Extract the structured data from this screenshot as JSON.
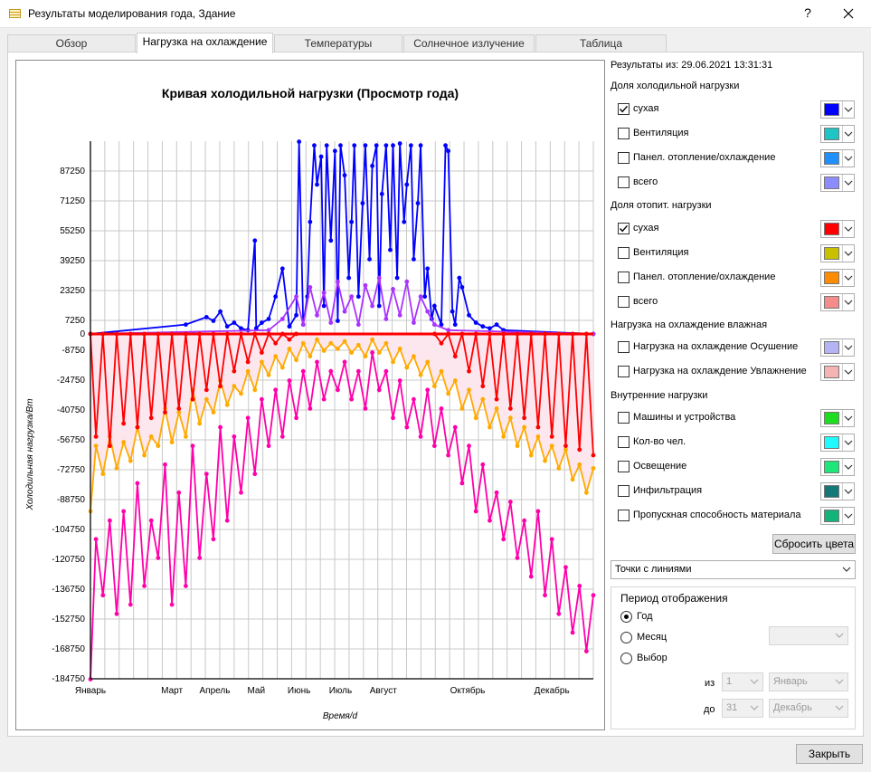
{
  "window": {
    "title": "Результаты моделирования года, Здание",
    "help_glyph": "?",
    "close_glyph": "✕"
  },
  "tabs": [
    {
      "label": "Обзор",
      "active": false
    },
    {
      "label": "Нагрузка на охлаждение",
      "active": true
    },
    {
      "label": "Температуры",
      "active": false
    },
    {
      "label": "Солнечное излучение",
      "active": false
    },
    {
      "label": "Таблица",
      "active": false
    }
  ],
  "chart_data": {
    "type": "line",
    "title": "Кривая холодильной нагрузки (Просмотр года)",
    "xlabel": "Время/d",
    "ylabel": "Холодильная нагрузка/Вт",
    "xlim": [
      1,
      365
    ],
    "ylim": [
      -184750,
      103250
    ],
    "y_ticks": [
      "87250",
      "71250",
      "55250",
      "39250",
      "23250",
      "7250",
      "0",
      "-8750",
      "-24750",
      "-40750",
      "-56750",
      "-72750",
      "-88750",
      "-104750",
      "-120750",
      "-136750",
      "-152750",
      "-168750",
      "-184750"
    ],
    "x_ticks": [
      {
        "day": 1,
        "label": "Январь"
      },
      {
        "day": 60,
        "label": "Март"
      },
      {
        "day": 91,
        "label": "Апрель"
      },
      {
        "day": 121,
        "label": "Май"
      },
      {
        "day": 152,
        "label": "Июнь"
      },
      {
        "day": 182,
        "label": "Июль"
      },
      {
        "day": 213,
        "label": "Август"
      },
      {
        "day": 274,
        "label": "Октябрь"
      },
      {
        "day": 335,
        "label": "Декабрь"
      }
    ],
    "grid": true,
    "series": [
      {
        "name": "сухая (доля холодильной нагрузки)",
        "color": "#0000ff",
        "x": [
          1,
          70,
          85,
          90,
          95,
          100,
          105,
          110,
          115,
          120,
          121,
          125,
          130,
          135,
          140,
          145,
          150,
          152,
          155,
          158,
          160,
          163,
          165,
          168,
          170,
          172,
          175,
          178,
          180,
          182,
          185,
          188,
          190,
          192,
          195,
          198,
          200,
          203,
          205,
          208,
          210,
          212,
          215,
          218,
          220,
          223,
          225,
          228,
          230,
          233,
          235,
          238,
          240,
          243,
          245,
          248,
          250,
          255,
          258,
          260,
          263,
          265,
          268,
          270,
          275,
          280,
          285,
          290,
          295,
          300,
          365
        ],
        "y": [
          0,
          5000,
          9000,
          7000,
          12000,
          4000,
          6000,
          3000,
          2000,
          50000,
          3000,
          6000,
          8000,
          20000,
          35000,
          4000,
          10000,
          103000,
          5000,
          20000,
          60000,
          101000,
          80000,
          95000,
          15000,
          101000,
          50000,
          98000,
          7000,
          101000,
          85000,
          30000,
          60000,
          101000,
          20000,
          70000,
          101000,
          40000,
          90000,
          101000,
          15000,
          75000,
          101000,
          45000,
          101000,
          30000,
          102000,
          60000,
          80000,
          101000,
          40000,
          70000,
          101000,
          20000,
          35000,
          8000,
          15000,
          5000,
          101000,
          98000,
          12000,
          5000,
          30000,
          25000,
          10000,
          6000,
          4000,
          3000,
          5000,
          2000,
          0
        ]
      },
      {
        "name": "всего (отопит. нагрузка)",
        "color": "#ff00aa",
        "x": [
          1,
          5,
          10,
          15,
          20,
          25,
          30,
          35,
          40,
          45,
          50,
          55,
          60,
          65,
          70,
          75,
          80,
          85,
          90,
          95,
          100,
          105,
          110,
          115,
          120,
          125,
          130,
          135,
          140,
          145,
          150,
          155,
          160,
          165,
          170,
          175,
          180,
          185,
          190,
          195,
          200,
          205,
          210,
          215,
          220,
          225,
          230,
          235,
          240,
          245,
          250,
          255,
          260,
          265,
          270,
          275,
          280,
          285,
          290,
          295,
          300,
          305,
          310,
          315,
          320,
          325,
          330,
          335,
          340,
          345,
          350,
          355,
          360,
          365
        ],
        "y": [
          -185000,
          -110000,
          -140000,
          -100000,
          -150000,
          -95000,
          -145000,
          -80000,
          -135000,
          -100000,
          -120000,
          -70000,
          -145000,
          -85000,
          -135000,
          -60000,
          -120000,
          -75000,
          -110000,
          -50000,
          -100000,
          -55000,
          -85000,
          -45000,
          -75000,
          -35000,
          -60000,
          -30000,
          -55000,
          -25000,
          -45000,
          -20000,
          -40000,
          -15000,
          -35000,
          -20000,
          -30000,
          -15000,
          -35000,
          -20000,
          -40000,
          -10000,
          -30000,
          -20000,
          -45000,
          -25000,
          -50000,
          -35000,
          -55000,
          -30000,
          -60000,
          -40000,
          -65000,
          -50000,
          -80000,
          -60000,
          -95000,
          -70000,
          -100000,
          -85000,
          -110000,
          -90000,
          -120000,
          -100000,
          -130000,
          -95000,
          -140000,
          -110000,
          -150000,
          -125000,
          -160000,
          -135000,
          -170000,
          -140000
        ]
      },
      {
        "name": "Панел. отопление/охлаждение (отопит.)",
        "color": "#ffaa00",
        "x": [
          1,
          5,
          10,
          15,
          20,
          25,
          30,
          35,
          40,
          45,
          50,
          55,
          60,
          65,
          70,
          75,
          80,
          85,
          90,
          95,
          100,
          105,
          110,
          115,
          120,
          125,
          130,
          135,
          140,
          145,
          150,
          155,
          160,
          165,
          170,
          175,
          180,
          185,
          190,
          195,
          200,
          205,
          210,
          215,
          220,
          225,
          230,
          235,
          240,
          245,
          250,
          255,
          260,
          265,
          270,
          275,
          280,
          285,
          290,
          295,
          300,
          305,
          310,
          315,
          320,
          325,
          330,
          335,
          340,
          345,
          350,
          355,
          360,
          365
        ],
        "y": [
          -95000,
          -60000,
          -75000,
          -55000,
          -72000,
          -58000,
          -68000,
          -50000,
          -65000,
          -55000,
          -60000,
          -40000,
          -58000,
          -42000,
          -55000,
          -30000,
          -48000,
          -35000,
          -42000,
          -25000,
          -38000,
          -28000,
          -32000,
          -20000,
          -30000,
          -15000,
          -22000,
          -12000,
          -18000,
          -8000,
          -14000,
          -5000,
          -12000,
          -3000,
          -9000,
          -5000,
          -8000,
          -4000,
          -10000,
          -6000,
          -12000,
          -3000,
          -10000,
          -5000,
          -15000,
          -8000,
          -18000,
          -12000,
          -22000,
          -15000,
          -28000,
          -20000,
          -32000,
          -25000,
          -40000,
          -30000,
          -45000,
          -35000,
          -50000,
          -40000,
          -55000,
          -45000,
          -60000,
          -50000,
          -65000,
          -55000,
          -68000,
          -60000,
          -72000,
          -62000,
          -78000,
          -70000,
          -85000,
          -72000
        ]
      },
      {
        "name": "Вентиляция (холодильная)",
        "color": "#aa33ff",
        "x": [
          1,
          130,
          140,
          150,
          155,
          160,
          165,
          170,
          175,
          180,
          185,
          190,
          195,
          200,
          205,
          210,
          215,
          220,
          225,
          230,
          235,
          240,
          245,
          250,
          260,
          365
        ],
        "y": [
          0,
          2000,
          8000,
          20000,
          5000,
          25000,
          10000,
          22000,
          6000,
          28000,
          12000,
          20000,
          5000,
          26000,
          15000,
          30000,
          8000,
          24000,
          10000,
          28000,
          6000,
          20000,
          12000,
          5000,
          2000,
          0
        ]
      },
      {
        "name": "сухая (доля отопит. нагрузки)",
        "color": "#ff0000",
        "x": [
          1,
          5,
          10,
          15,
          20,
          25,
          30,
          35,
          40,
          45,
          50,
          55,
          60,
          65,
          70,
          75,
          80,
          85,
          90,
          95,
          100,
          105,
          110,
          115,
          120,
          125,
          130,
          135,
          140,
          145,
          150,
          250,
          255,
          260,
          265,
          270,
          275,
          280,
          285,
          290,
          295,
          300,
          305,
          310,
          315,
          320,
          325,
          330,
          335,
          340,
          345,
          350,
          355,
          360,
          365
        ],
        "y": [
          0,
          -55000,
          0,
          -60000,
          0,
          -48000,
          0,
          -50000,
          0,
          -45000,
          0,
          -42000,
          0,
          -40000,
          0,
          -35000,
          0,
          -30000,
          0,
          -28000,
          0,
          -20000,
          0,
          -15000,
          0,
          -10000,
          0,
          -5000,
          0,
          -3000,
          0,
          0,
          -5000,
          0,
          -12000,
          0,
          -20000,
          0,
          -28000,
          0,
          -35000,
          0,
          -40000,
          0,
          -45000,
          0,
          -50000,
          0,
          -55000,
          0,
          -60000,
          0,
          -62000,
          0,
          -65000
        ]
      }
    ]
  },
  "side": {
    "results_from": "Результаты из: 29.06.2021 13:31:31",
    "cooling_share": {
      "title": "Доля холодильной нагрузки",
      "items": [
        {
          "label": "сухая",
          "checked": true,
          "color": "#0000ff"
        },
        {
          "label": "Вентиляция",
          "checked": false,
          "color": "#1fc5c5"
        },
        {
          "label": "Панел. отопление/охлаждение",
          "checked": false,
          "color": "#1e90ff"
        },
        {
          "label": "всего",
          "checked": false,
          "color": "#8c8cff"
        }
      ]
    },
    "heating_share": {
      "title": "Доля отопит. нагрузки",
      "items": [
        {
          "label": "сухая",
          "checked": true,
          "color": "#ff0000"
        },
        {
          "label": "Вентиляция",
          "checked": false,
          "color": "#c8c000"
        },
        {
          "label": "Панел. отопление/охлаждение",
          "checked": false,
          "color": "#ff8c00"
        },
        {
          "label": "всего",
          "checked": false,
          "color": "#f48c8c"
        }
      ]
    },
    "latent": {
      "title": "Нагрузка на охлаждение влажная",
      "items": [
        {
          "label": "Нагрузка на охлаждение Осушение",
          "checked": false,
          "color": "#b4b4f5"
        },
        {
          "label": "Нагрузка на охлаждение Увлажнение",
          "checked": false,
          "color": "#f5b4b4"
        }
      ]
    },
    "internal": {
      "title": "Внутренние нагрузки",
      "items": [
        {
          "label": "Машины и устройства",
          "checked": false,
          "color": "#1edc1e"
        },
        {
          "label": "Кол-во чел.",
          "checked": false,
          "color": "#1efaff"
        },
        {
          "label": "Освещение",
          "checked": false,
          "color": "#1ee678"
        },
        {
          "label": "Инфильтрация",
          "checked": false,
          "color": "#147878"
        },
        {
          "label": "Пропускная способность материала",
          "checked": false,
          "color": "#14b478"
        }
      ]
    },
    "reset_colors": "Сбросить цвета",
    "display_mode": "Точки с линиями",
    "period": {
      "title": "Период отображения",
      "options": [
        {
          "label": "Год",
          "selected": true
        },
        {
          "label": "Месяц",
          "selected": false
        },
        {
          "label": "Выбор",
          "selected": false
        }
      ],
      "from_label": "из",
      "to_label": "до",
      "from_day": "1",
      "from_month": "Январь",
      "to_day": "31",
      "to_month": "Декабрь",
      "month_value": ""
    }
  },
  "close_button": "Закрыть"
}
